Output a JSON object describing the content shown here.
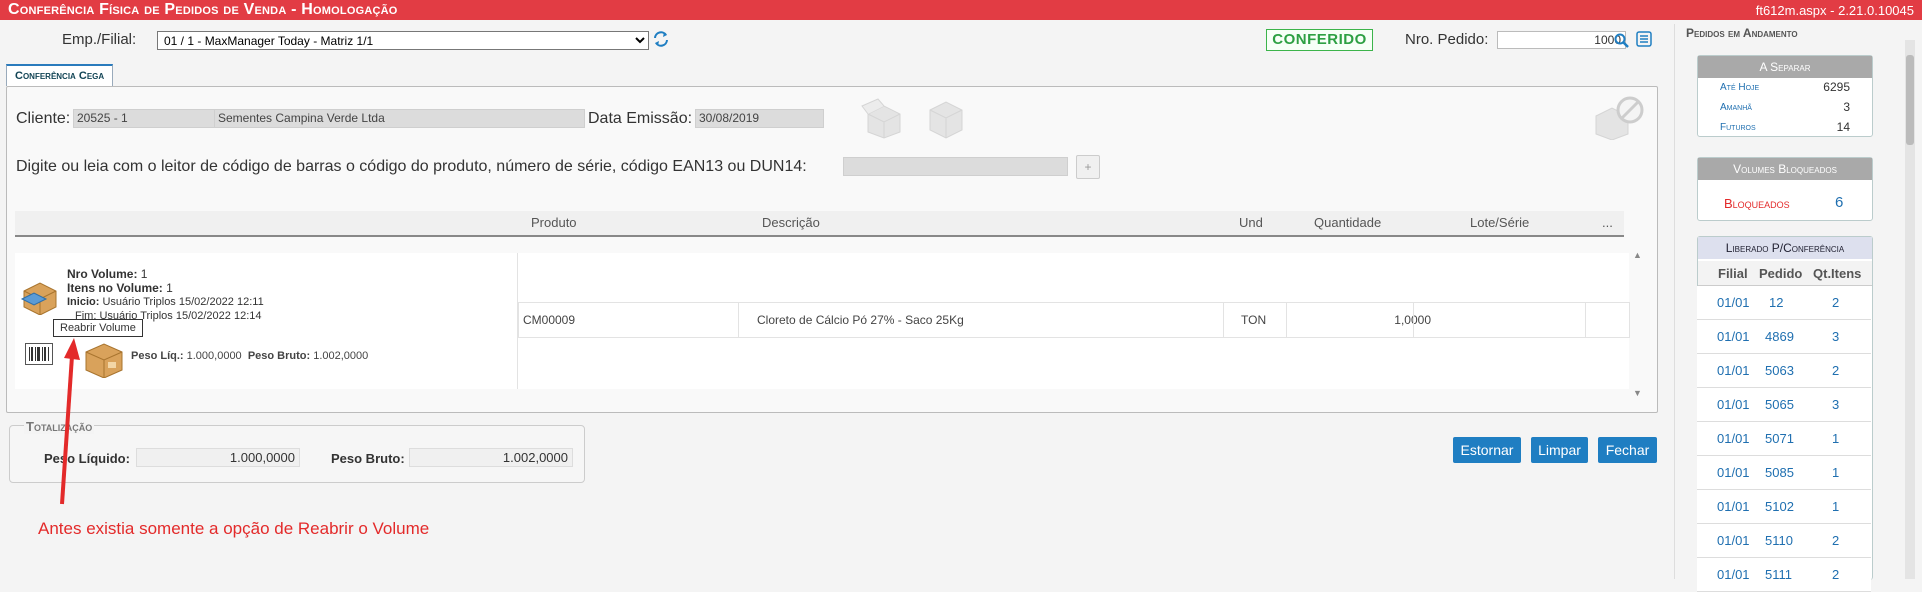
{
  "header": {
    "title": "Conferência Física de Pedidos de Venda  - Homologação",
    "version": "ft612m.aspx - 2.21.0.10045"
  },
  "toolbar": {
    "emp_label": "Emp./Filial:",
    "emp_value": "01 / 1 - MaxManager Today - Matriz 1/1",
    "status": "CONFERIDO",
    "pedido_label": "Nro. Pedido:",
    "pedido_value": "1000"
  },
  "tab": {
    "label": "Conferência Cega"
  },
  "order": {
    "cliente_label": "Cliente:",
    "cliente_code": "20525 - 1",
    "cliente_name": "Sementes Campina Verde Ltda",
    "data_label": "Data Emissão:",
    "data_value": "30/08/2019",
    "scan_prompt": "Digite ou leia com o leitor de código de barras o código do produto, número de série, código EAN13 ou DUN14:",
    "add_button": "+"
  },
  "grid": {
    "columns": [
      "Produto",
      "Descrição",
      "Und",
      "Quantidade",
      "Lote/Série",
      "..."
    ],
    "rows": [
      {
        "produto": "CM00009",
        "descricao": "Cloreto de Cálcio Pó 27% - Saco 25Kg",
        "und": "TON",
        "quantidade": "1,0000",
        "lote": ""
      }
    ]
  },
  "volume": {
    "nro_label": "Nro Volume:",
    "nro_value": "1",
    "itens_label": "Itens no Volume:",
    "itens_value": "1",
    "inicio_label": "Inicio:",
    "inicio_value": "Usuário Triplos 15/02/2022 12:11",
    "fim_value": "Usuário Triplos 15/02/2022 12:14",
    "fim_visible": "Fim: Usuário Triplos 15/02/2022 12:14",
    "peso_liq_label": "Peso Líq.:",
    "peso_liq_value": "1.000,0000",
    "peso_bruto_label": "Peso Bruto:",
    "peso_bruto_value": "1.002,0000",
    "tooltip": "Reabrir Volume"
  },
  "totals": {
    "legend": "Totalização",
    "liq_label": "Peso Líquido:",
    "liq_value": "1.000,0000",
    "bruto_label": "Peso Bruto:",
    "bruto_value": "1.002,0000"
  },
  "buttons": {
    "estornar": "Estornar",
    "limpar": "Limpar",
    "fechar": "Fechar"
  },
  "annotation": "Antes existia somente a opção de Reabrir o Volume",
  "sidebar": {
    "title": "Pedidos em Andamento",
    "separar": {
      "title": "A Separar",
      "items": [
        {
          "label": "Até Hoje",
          "value": "6295"
        },
        {
          "label": "Amanhã",
          "value": "3"
        },
        {
          "label": "Futuros",
          "value": "14"
        }
      ]
    },
    "bloqueados": {
      "title": "Volumes Bloqueados",
      "label": "Bloqueados",
      "value": "6"
    },
    "liberado": {
      "title": "Liberado P/Conferência",
      "columns": [
        "Filial",
        "Pedido",
        "Qt.Itens"
      ],
      "rows": [
        {
          "filial": "01/01",
          "pedido": "12",
          "qt": "2"
        },
        {
          "filial": "01/01",
          "pedido": "4869",
          "qt": "3"
        },
        {
          "filial": "01/01",
          "pedido": "5063",
          "qt": "2"
        },
        {
          "filial": "01/01",
          "pedido": "5065",
          "qt": "3"
        },
        {
          "filial": "01/01",
          "pedido": "5071",
          "qt": "1"
        },
        {
          "filial": "01/01",
          "pedido": "5085",
          "qt": "1"
        },
        {
          "filial": "01/01",
          "pedido": "5102",
          "qt": "1"
        },
        {
          "filial": "01/01",
          "pedido": "5110",
          "qt": "2"
        },
        {
          "filial": "01/01",
          "pedido": "5111",
          "qt": "2"
        }
      ]
    }
  },
  "colors": {
    "titlebar": "#e23c44",
    "accent": "#1f7ec2",
    "status": "#2ea043",
    "annotation": "#e32a2a"
  }
}
